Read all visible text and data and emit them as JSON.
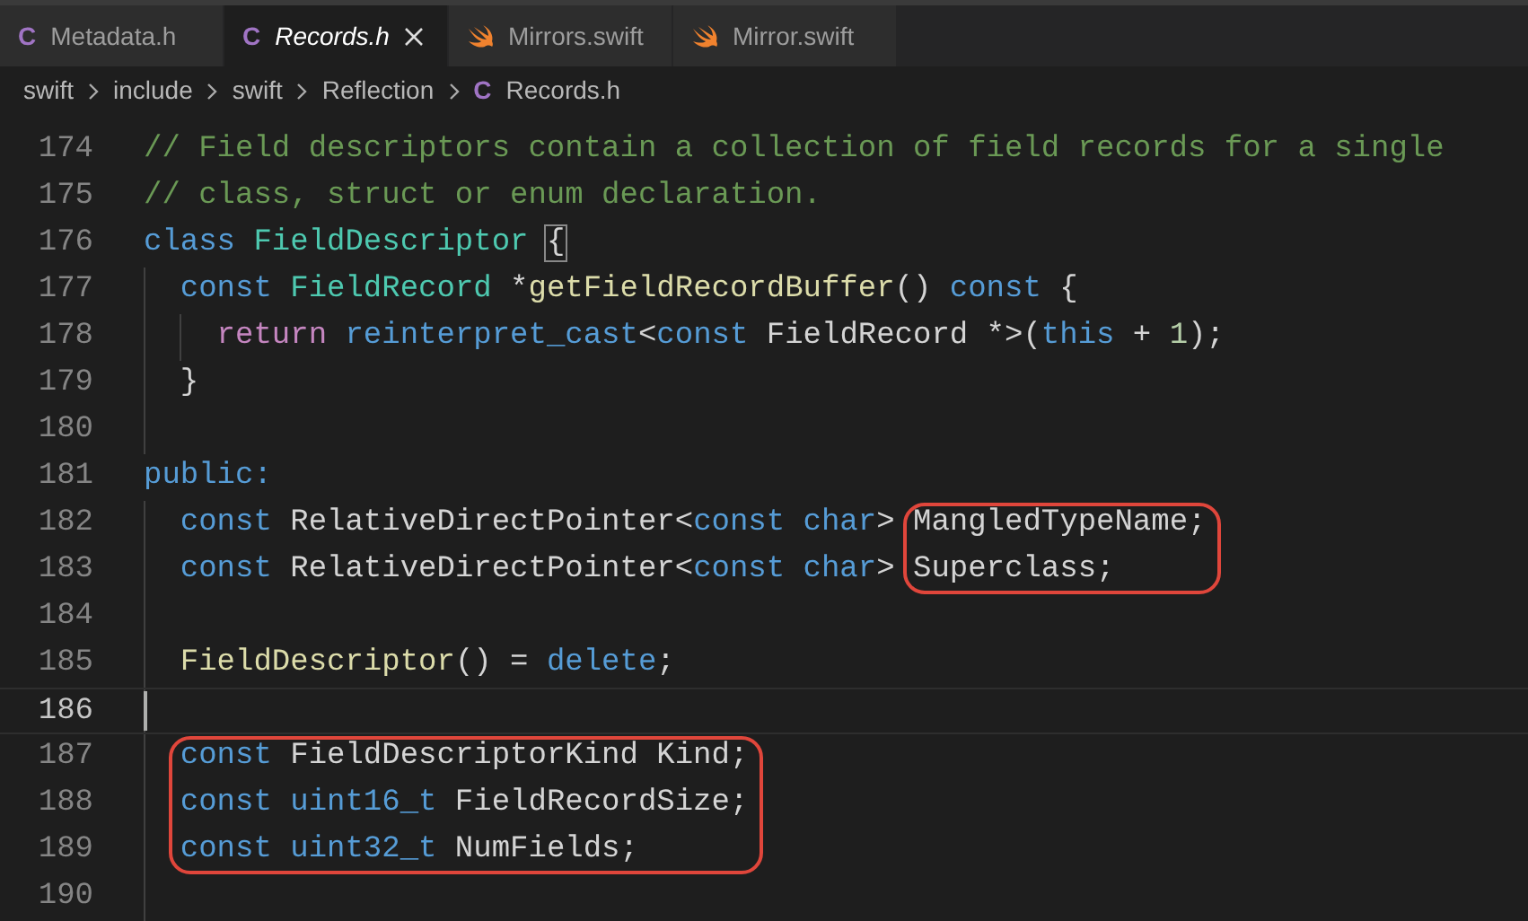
{
  "tabs": [
    {
      "label": "Metadata.h",
      "kind": "c",
      "icon_text": "C",
      "selected": false,
      "italic": false
    },
    {
      "label": "Records.h",
      "kind": "c",
      "icon_text": "C",
      "selected": true,
      "italic": true
    },
    {
      "label": "Mirrors.swift",
      "kind": "swift",
      "selected": false,
      "italic": false
    },
    {
      "label": "Mirror.swift",
      "kind": "swift",
      "selected": false,
      "italic": false
    }
  ],
  "breadcrumb": [
    {
      "label": "swift"
    },
    {
      "label": "include"
    },
    {
      "label": "swift"
    },
    {
      "label": "Reflection"
    },
    {
      "label": "Records.h",
      "icon_text": "C"
    }
  ],
  "lines": [
    {
      "number": "174",
      "in_block": false,
      "tokens": [
        {
          "kind": "comment",
          "text": "// Field descriptors contain a collection of field records for a single"
        }
      ]
    },
    {
      "number": "175",
      "in_block": false,
      "tokens": [
        {
          "kind": "comment",
          "text": "// class, struct or enum declaration."
        }
      ]
    },
    {
      "number": "176",
      "in_block": false,
      "tokens": [
        {
          "kind": "keyword",
          "text": "class"
        },
        {
          "kind": "type",
          "text": " FieldDescriptor "
        },
        {
          "kind": "bracket",
          "text": "{"
        }
      ]
    },
    {
      "number": "177",
      "in_block": true,
      "tokens": [
        {
          "kind": "keyword",
          "text": "  const"
        },
        {
          "kind": "type",
          "text": " FieldRecord"
        },
        {
          "kind": "plain",
          "text": " *"
        },
        {
          "kind": "function",
          "text": "getFieldRecordBuffer"
        },
        {
          "kind": "plain",
          "text": "() "
        },
        {
          "kind": "keyword",
          "text": "const"
        },
        {
          "kind": "plain",
          "text": " {"
        }
      ]
    },
    {
      "number": "178",
      "in_block": true,
      "tokens": [
        {
          "kind": "control",
          "text": "    return"
        },
        {
          "kind": "keyword",
          "text": " reinterpret_cast"
        },
        {
          "kind": "plain",
          "text": "<"
        },
        {
          "kind": "keyword",
          "text": "const"
        },
        {
          "kind": "plain",
          "text": " FieldRecord *>("
        },
        {
          "kind": "keyword",
          "text": "this"
        },
        {
          "kind": "plain",
          "text": " + "
        },
        {
          "kind": "number",
          "text": "1"
        },
        {
          "kind": "plain",
          "text": ");"
        }
      ]
    },
    {
      "number": "179",
      "in_block": true,
      "tokens": [
        {
          "kind": "plain",
          "text": "  }"
        }
      ]
    },
    {
      "number": "180",
      "in_block": true
    },
    {
      "number": "181",
      "in_block": false,
      "tokens": [
        {
          "kind": "keyword",
          "text": "public:"
        }
      ]
    },
    {
      "number": "182",
      "in_block": true,
      "tokens": [
        {
          "kind": "keyword",
          "text": "  const"
        },
        {
          "kind": "plain",
          "text": " RelativeDirectPointer<"
        },
        {
          "kind": "keyword",
          "text": "const char"
        },
        {
          "kind": "plain",
          "text": "> "
        },
        {
          "kind": "plain",
          "text": "MangledTypeName;",
          "circled": true
        }
      ]
    },
    {
      "number": "183",
      "in_block": true,
      "tokens": [
        {
          "kind": "keyword",
          "text": "  const"
        },
        {
          "kind": "plain",
          "text": " RelativeDirectPointer<"
        },
        {
          "kind": "keyword",
          "text": "const char"
        },
        {
          "kind": "plain",
          "text": "> "
        },
        {
          "kind": "plain",
          "text": "Superclass;",
          "circled": true
        }
      ]
    },
    {
      "number": "184",
      "in_block": true
    },
    {
      "number": "185",
      "in_block": true,
      "tokens": [
        {
          "kind": "function",
          "text": "  FieldDescriptor"
        },
        {
          "kind": "plain",
          "text": "() = "
        },
        {
          "kind": "keyword",
          "text": "delete"
        },
        {
          "kind": "plain",
          "text": ";"
        }
      ]
    },
    {
      "number": "186",
      "in_block": true,
      "current": true
    },
    {
      "number": "187",
      "in_block": true,
      "tokens": [
        {
          "kind": "keyword",
          "text": "  const",
          "circled": true
        },
        {
          "kind": "plain",
          "text": " FieldDescriptorKind Kind;",
          "circled": true
        }
      ]
    },
    {
      "number": "188",
      "in_block": true,
      "tokens": [
        {
          "kind": "keyword",
          "text": "  const uint16_t",
          "circled": true
        },
        {
          "kind": "plain",
          "text": " FieldRecordSize;",
          "circled": true
        }
      ]
    },
    {
      "number": "189",
      "in_block": true,
      "tokens": [
        {
          "kind": "keyword",
          "text": "  const uint32_t",
          "circled": true
        },
        {
          "kind": "plain",
          "text": " NumFields;",
          "circled": true
        }
      ]
    },
    {
      "number": "190",
      "in_block": true
    }
  ]
}
